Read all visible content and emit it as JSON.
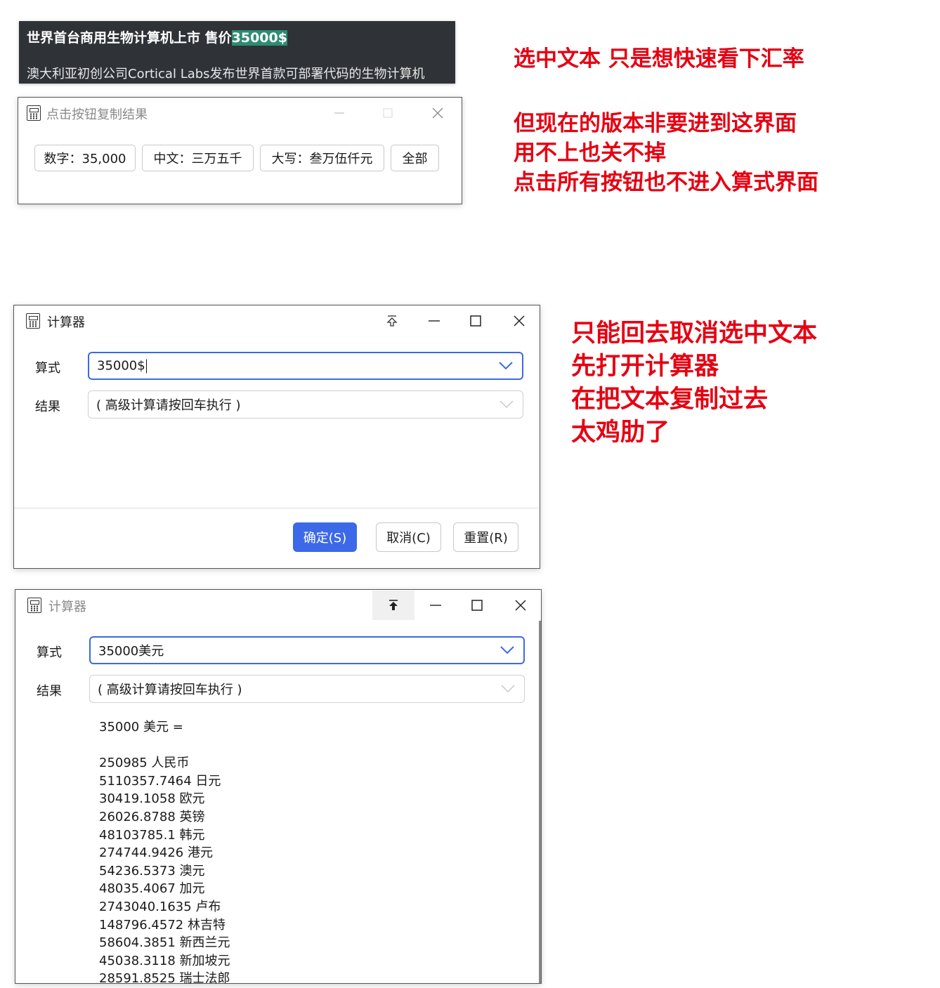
{
  "article": {
    "title_prefix": "世界首台商用生物计算机上市 售价",
    "title_selected": "35000$",
    "body": "澳大利亚初创公司Cortical Labs发布世界首款可部署代码的生物计算机"
  },
  "popup": {
    "title": "点击按钮复制结果",
    "buttons": [
      "数字：35,000",
      "中文：三万五千",
      "大写：叁万伍仟元",
      "全部"
    ]
  },
  "calc1": {
    "title": "计算器",
    "formula_label": "算式",
    "formula_value": "35000$",
    "result_label": "结果",
    "result_value": "( 高级计算请按回车执行 )",
    "confirm_label": "确定(S)",
    "cancel_label": "取消(C)",
    "reset_label": "重置(R)"
  },
  "calc2": {
    "title": "计算器",
    "formula_label": "算式",
    "formula_value": "35000美元",
    "result_label": "结果",
    "result_value": "( 高级计算请按回车执行 )",
    "output_header": "35000 美元 =",
    "output_lines": [
      "250985 人民币",
      "5110357.7464 日元",
      "30419.1058 欧元",
      "26026.8788 英镑",
      "48103785.1 韩元",
      "274744.9426 港元",
      "54236.5373 澳元",
      "48035.4067 加元",
      "2743040.1635 卢布",
      "148796.4572 林吉特",
      "58604.3851 新西兰元",
      "45038.3118 新加坡元",
      "28591.8525 瑞士法郎"
    ]
  },
  "notes": {
    "n1": "选中文本 只是想快速看下汇率",
    "n2": [
      "但现在的版本非要进到这界面",
      "用不上也关不掉",
      "点击所有按钮也不进入算式界面"
    ],
    "n3": [
      "只能回去取消选中文本",
      "先打开计算器",
      "在把文本复制过去",
      "太鸡肋了"
    ]
  },
  "colors": {
    "accent": "#3c69e7",
    "annotation": "#e60012",
    "article_bg": "#2f3237",
    "selection": "#2e8b74"
  },
  "icons": [
    "calculator-icon",
    "pin-icon",
    "minimize-icon",
    "maximize-icon",
    "close-icon",
    "chevron-down-icon"
  ]
}
